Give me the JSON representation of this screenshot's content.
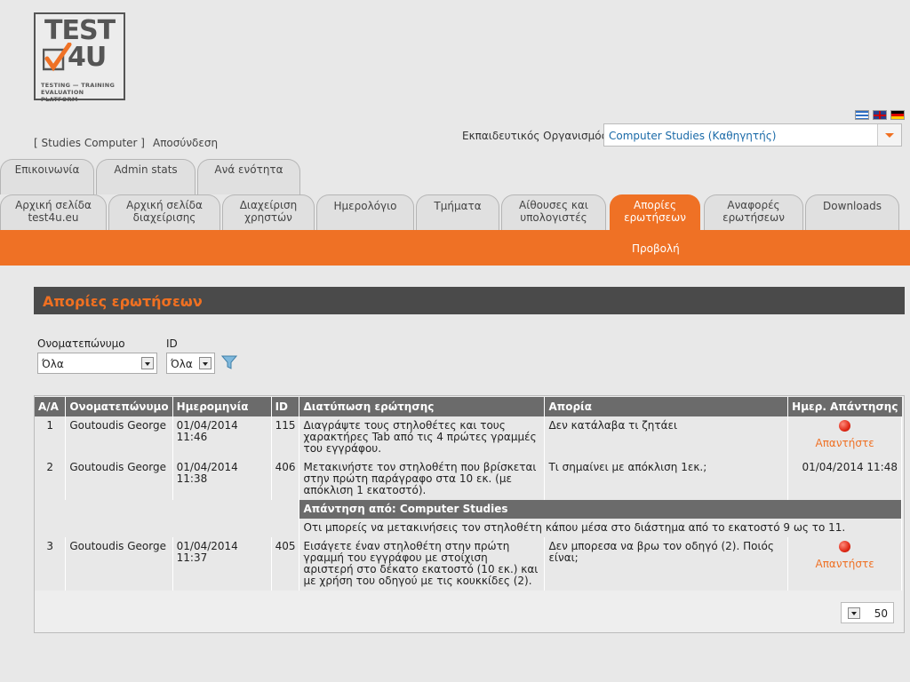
{
  "logo": {
    "line1": "TEST",
    "line2": "4U",
    "tagline": "TESTING — TRAINING EVALUATION PLATFORM"
  },
  "flags": [
    "greek-flag-icon",
    "uk-flag-icon",
    "german-flag-icon"
  ],
  "header": {
    "user_link": "[ Studies Computer ]",
    "logout": "Αποσύνδεση",
    "org_label": "Εκπαιδευτικός Οργανισμός:",
    "org_value": "Computer Studies (Καθηγητής)"
  },
  "tabs_top": [
    "Επικοινωνία",
    "Admin stats",
    "Ανά ενότητα"
  ],
  "tabs_main": [
    "Αρχική σελίδα\ntest4u.eu",
    "Αρχική σελίδα\nδιαχείρισης",
    "Διαχείριση\nχρηστών",
    "Ημερολόγιο",
    "Τμήματα",
    "Αίθουσες και\nυπολογιστές",
    "Απορίες\nερωτήσεων",
    "Αναφορές\nερωτήσεων",
    "Downloads"
  ],
  "subnav": "Προβολή",
  "page_title": "Απορίες ερωτήσεων",
  "filters": {
    "name_label": "Ονοματεπώνυμο",
    "name_value": "Όλα",
    "id_label": "ID",
    "id_value": "Όλα",
    "filter_icon": "funnel-icon"
  },
  "table": {
    "columns": [
      "A/A",
      "Ονοματεπώνυμο",
      "Ημερομηνία",
      "ID",
      "Διατύπωση ερώτησης",
      "Απορία",
      "Ημερ. Απάντησης"
    ],
    "rows": [
      {
        "aa": "1",
        "name": "Goutoudis George",
        "date": "01/04/2014 11:46",
        "id": "115",
        "question": "Διαγράψτε τους στηλοθέτες και τους χαρακτήρες Tab από τις 4 πρώτες γραμμές του εγγράφου.",
        "issue": "Δεν κατάλαβα τι ζητάει",
        "answer_date": "",
        "reply_label": "Απαντήστε"
      },
      {
        "aa": "2",
        "name": "Goutoudis George",
        "date": "01/04/2014 11:38",
        "id": "406",
        "question": "Μετακινήστε τον στηλοθέτη που βρίσκεται στην πρώτη παράγραφο στα 10 εκ. (με απόκλιση 1 εκατοστό).",
        "issue": "Τι σημαίνει με απόκλιση 1εκ.;",
        "answer_date": "01/04/2014 11:48",
        "answer_header": "Απάντηση από: Computer Studies",
        "answer_text": "Οτι μπορείς να μετακινήσεις τον στηλοθέτη κάπου μέσα στο διάστημα από το εκατοστό 9 ως το 11."
      },
      {
        "aa": "3",
        "name": "Goutoudis George",
        "date": "01/04/2014 11:37",
        "id": "405",
        "question": "Εισάγετε έναν στηλοθέτη στην πρώτη γραμμή του εγγράφου με στοίχιση αριστερή στο δέκατο εκατοστό (10 εκ.) και με χρήση του οδηγού με τις κουκκίδες (2).",
        "issue": "Δεν μπορεσα να βρω τον οδηγό (2). Ποιός είναι;",
        "answer_date": "",
        "reply_label": "Απαντήστε"
      }
    ]
  },
  "pager": {
    "page_size": "50"
  },
  "colors": {
    "accent": "#ef7125",
    "header_bar": "#4a4a4a",
    "table_head": "#6b6b6b",
    "link": "#1a6aa8"
  }
}
